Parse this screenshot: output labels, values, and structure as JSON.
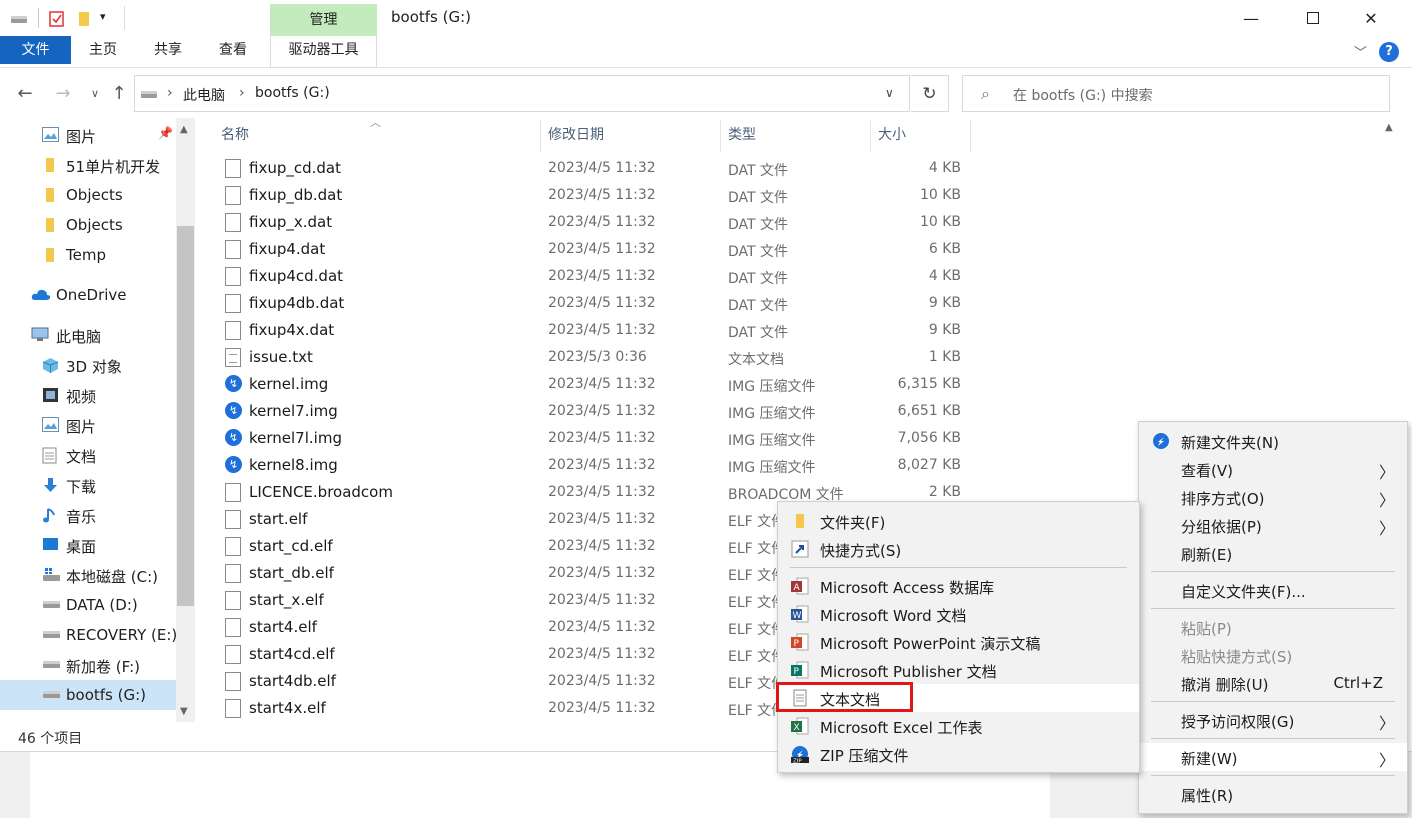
{
  "window": {
    "title": "bootfs (G:)",
    "context_tab": "管理"
  },
  "ribbon": {
    "tabs": [
      "文件",
      "主页",
      "共享",
      "查看",
      "驱动器工具"
    ]
  },
  "address": {
    "crumbs": [
      "此电脑",
      "bootfs (G:)"
    ],
    "search_placeholder": "在 bootfs (G:) 中搜索"
  },
  "nav": {
    "items": [
      {
        "label": "图片",
        "icon": "pictures-icon"
      },
      {
        "label": "51单片机开发",
        "icon": "folder-icon"
      },
      {
        "label": "Objects",
        "icon": "folder-icon"
      },
      {
        "label": "Objects",
        "icon": "folder-icon"
      },
      {
        "label": "Temp",
        "icon": "folder-icon"
      },
      {
        "label": "OneDrive",
        "icon": "cloud-icon"
      },
      {
        "label": "此电脑",
        "icon": "computer-icon"
      },
      {
        "label": "3D 对象",
        "icon": "cube-icon"
      },
      {
        "label": "视频",
        "icon": "video-icon"
      },
      {
        "label": "图片",
        "icon": "pictures-icon"
      },
      {
        "label": "文档",
        "icon": "document-icon"
      },
      {
        "label": "下载",
        "icon": "download-icon"
      },
      {
        "label": "音乐",
        "icon": "music-icon"
      },
      {
        "label": "桌面",
        "icon": "desktop-icon"
      },
      {
        "label": "本地磁盘 (C:)",
        "icon": "windows-drive-icon"
      },
      {
        "label": "DATA (D:)",
        "icon": "drive-icon"
      },
      {
        "label": "RECOVERY (E:)",
        "icon": "drive-icon"
      },
      {
        "label": "新加卷 (F:)",
        "icon": "drive-icon"
      },
      {
        "label": "bootfs (G:)",
        "icon": "drive-icon"
      }
    ]
  },
  "columns": [
    "名称",
    "修改日期",
    "类型",
    "大小"
  ],
  "files": [
    {
      "name": "fixup_cd.dat",
      "date": "2023/4/5 11:32",
      "type": "DAT 文件",
      "size": "4 KB",
      "icon": "file-icon"
    },
    {
      "name": "fixup_db.dat",
      "date": "2023/4/5 11:32",
      "type": "DAT 文件",
      "size": "10 KB",
      "icon": "file-icon"
    },
    {
      "name": "fixup_x.dat",
      "date": "2023/4/5 11:32",
      "type": "DAT 文件",
      "size": "10 KB",
      "icon": "file-icon"
    },
    {
      "name": "fixup4.dat",
      "date": "2023/4/5 11:32",
      "type": "DAT 文件",
      "size": "6 KB",
      "icon": "file-icon"
    },
    {
      "name": "fixup4cd.dat",
      "date": "2023/4/5 11:32",
      "type": "DAT 文件",
      "size": "4 KB",
      "icon": "file-icon"
    },
    {
      "name": "fixup4db.dat",
      "date": "2023/4/5 11:32",
      "type": "DAT 文件",
      "size": "9 KB",
      "icon": "file-icon"
    },
    {
      "name": "fixup4x.dat",
      "date": "2023/4/5 11:32",
      "type": "DAT 文件",
      "size": "9 KB",
      "icon": "file-icon"
    },
    {
      "name": "issue.txt",
      "date": "2023/5/3 0:36",
      "type": "文本文档",
      "size": "1 KB",
      "icon": "text-file-icon"
    },
    {
      "name": "kernel.img",
      "date": "2023/4/5 11:32",
      "type": "IMG 压缩文件",
      "size": "6,315 KB",
      "icon": "img-archive-icon"
    },
    {
      "name": "kernel7.img",
      "date": "2023/4/5 11:32",
      "type": "IMG 压缩文件",
      "size": "6,651 KB",
      "icon": "img-archive-icon"
    },
    {
      "name": "kernel7l.img",
      "date": "2023/4/5 11:32",
      "type": "IMG 压缩文件",
      "size": "7,056 KB",
      "icon": "img-archive-icon"
    },
    {
      "name": "kernel8.img",
      "date": "2023/4/5 11:32",
      "type": "IMG 压缩文件",
      "size": "8,027 KB",
      "icon": "img-archive-icon"
    },
    {
      "name": "LICENCE.broadcom",
      "date": "2023/4/5 11:32",
      "type": "BROADCOM 文件",
      "size": "2 KB",
      "icon": "file-icon"
    },
    {
      "name": "start.elf",
      "date": "2023/4/5 11:32",
      "type": "ELF 文件",
      "size": "",
      "icon": "file-icon"
    },
    {
      "name": "start_cd.elf",
      "date": "2023/4/5 11:32",
      "type": "ELF 文件",
      "size": "",
      "icon": "file-icon"
    },
    {
      "name": "start_db.elf",
      "date": "2023/4/5 11:32",
      "type": "ELF 文件",
      "size": "",
      "icon": "file-icon"
    },
    {
      "name": "start_x.elf",
      "date": "2023/4/5 11:32",
      "type": "ELF 文件",
      "size": "",
      "icon": "file-icon"
    },
    {
      "name": "start4.elf",
      "date": "2023/4/5 11:32",
      "type": "ELF 文件",
      "size": "",
      "icon": "file-icon"
    },
    {
      "name": "start4cd.elf",
      "date": "2023/4/5 11:32",
      "type": "ELF 文件",
      "size": "",
      "icon": "file-icon"
    },
    {
      "name": "start4db.elf",
      "date": "2023/4/5 11:32",
      "type": "ELF 文件",
      "size": "",
      "icon": "file-icon"
    },
    {
      "name": "start4x.elf",
      "date": "2023/4/5 11:32",
      "type": "ELF 文件",
      "size": "",
      "icon": "file-icon"
    }
  ],
  "status": "46 个项目",
  "context_menu": {
    "new_folder": "新建文件夹(N)",
    "view": "查看(V)",
    "sort": "排序方式(O)",
    "group": "分组依据(P)",
    "refresh": "刷新(E)",
    "customize": "自定义文件夹(F)...",
    "paste": "粘贴(P)",
    "paste_shortcut": "粘贴快捷方式(S)",
    "undo": "撤消 删除(U)",
    "undo_key": "Ctrl+Z",
    "grant_access": "授予访问权限(G)",
    "new": "新建(W)",
    "properties": "属性(R)"
  },
  "new_submenu": {
    "folder": "文件夹(F)",
    "shortcut": "快捷方式(S)",
    "access": "Microsoft Access 数据库",
    "word": "Microsoft Word 文档",
    "powerpoint": "Microsoft PowerPoint 演示文稿",
    "publisher": "Microsoft Publisher 文档",
    "text": "文本文档",
    "excel": "Microsoft Excel 工作表",
    "zip": "ZIP 压缩文件"
  },
  "colors": {
    "file_tab": "#1565c0",
    "context_tab": "#c4ebbe",
    "selection": "#cce4f7",
    "highlight_box": "#e01717"
  }
}
